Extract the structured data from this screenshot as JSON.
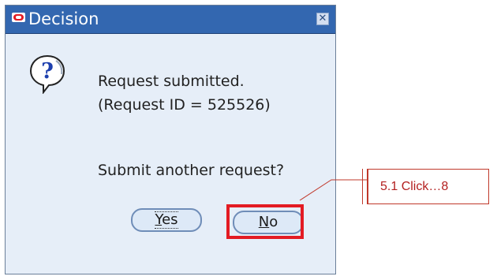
{
  "dialog": {
    "title": "Decision",
    "close_glyph": "✕",
    "icon": "question-icon",
    "message_line1": "Request submitted.",
    "message_line2": "(Request ID = 525526)",
    "question": "Submit another request?",
    "buttons": {
      "yes": {
        "mnemonic": "Y",
        "rest": "es"
      },
      "no": {
        "mnemonic": "N",
        "rest": "o"
      }
    }
  },
  "annotation": {
    "callout_text": "5.1 Click…8",
    "highlight_color": "#e31b23"
  },
  "colors": {
    "titlebar": "#3367b0",
    "dialog_bg": "#e6eef8",
    "button_border": "#6f8db8"
  }
}
